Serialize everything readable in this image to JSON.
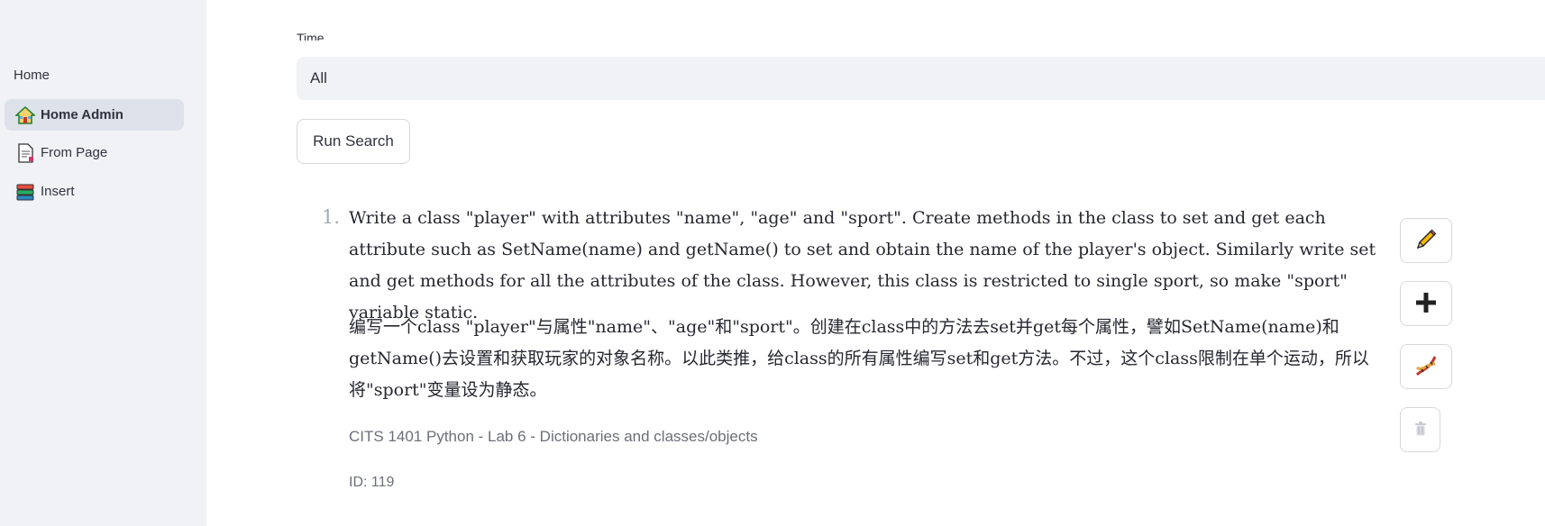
{
  "sidebar": {
    "heading": "Home",
    "items": [
      {
        "label": "Home Admin",
        "icon": "house-icon",
        "active": true
      },
      {
        "label": "From Page",
        "icon": "page-icon",
        "active": false
      },
      {
        "label": "Insert",
        "icon": "books-icon",
        "active": false
      }
    ]
  },
  "filter": {
    "label": "Time",
    "selected": "All"
  },
  "run_button": "Run Search",
  "results": [
    {
      "number": "1.",
      "text_en": "Write a class \"player\" with attributes \"name\", \"age\" and \"sport\". Create methods in the class to set and get each attribute such as SetName(name) and getName() to set and obtain the name of the player's object. Similarly write set and get methods for all the attributes of the class. However, this class is restricted to single sport, so make \"sport\" variable static.",
      "text_zh": "编写一个class \"player\"与属性\"name\"、\"age\"和\"sport\"。创建在class中的方法去set并get每个属性，譬如SetName(name)和getName()去设置和获取玩家的对象名称。以此类推，给class的所有属性编写set和get方法。不过，这个class限制在单个运动，所以将\"sport\"变量设为静态。",
      "source": "CITS 1401 Python - Lab 6 - Dictionaries and classes/objects",
      "id": "ID: 119",
      "actions": [
        "pencil-icon",
        "plus-icon",
        "dna-icon",
        "trash-icon"
      ]
    }
  ],
  "colors": {
    "sidebar_bg": "#f0f2f6",
    "active_item_bg": "#dde1ea",
    "input_bg": "#f0f2f6",
    "text": "#31333f",
    "muted": "#6b6f7a"
  }
}
